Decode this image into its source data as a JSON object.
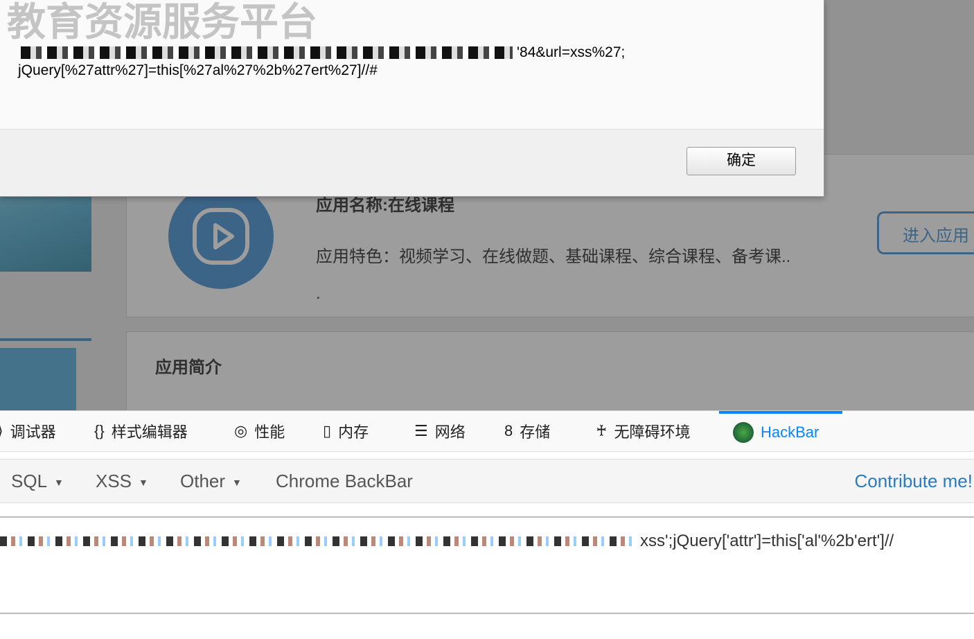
{
  "background_page": {
    "site_title": "教育资源服务平台",
    "app_name": "应用名称:在线课程",
    "app_features": "应用特色：视频学习、在线做题、基础课程、综合课程、备考课..",
    "dot": ".",
    "enter_button": "进入应用",
    "intro_heading": "应用简介"
  },
  "alert_dialog": {
    "message_line1_visible": "'84&url=xss%27;",
    "message_line2": "jQuery[%27attr%27]=this[%27al%27%2b%27ert%27]//#",
    "ok_button": "确定"
  },
  "devtools": {
    "tabs": [
      {
        "label": "调试器",
        "icon": "debugger-icon"
      },
      {
        "label": "样式编辑器",
        "icon": "braces-icon"
      },
      {
        "label": "性能",
        "icon": "performance-icon"
      },
      {
        "label": "内存",
        "icon": "memory-icon"
      },
      {
        "label": "网络",
        "icon": "network-icon"
      },
      {
        "label": "存储",
        "icon": "storage-icon"
      },
      {
        "label": "无障碍环境",
        "icon": "accessibility-icon"
      },
      {
        "label": "HackBar",
        "icon": "hackbar-icon",
        "active": true
      }
    ],
    "accent": "#0a84ff"
  },
  "hackbar": {
    "menus": [
      "SQL",
      "XSS",
      "Other"
    ],
    "chrome_backbar": "Chrome BackBar",
    "contribute": "Contribute me!",
    "url_visible": "xss';jQuery['attr']=this['al'%2b'ert']//"
  }
}
